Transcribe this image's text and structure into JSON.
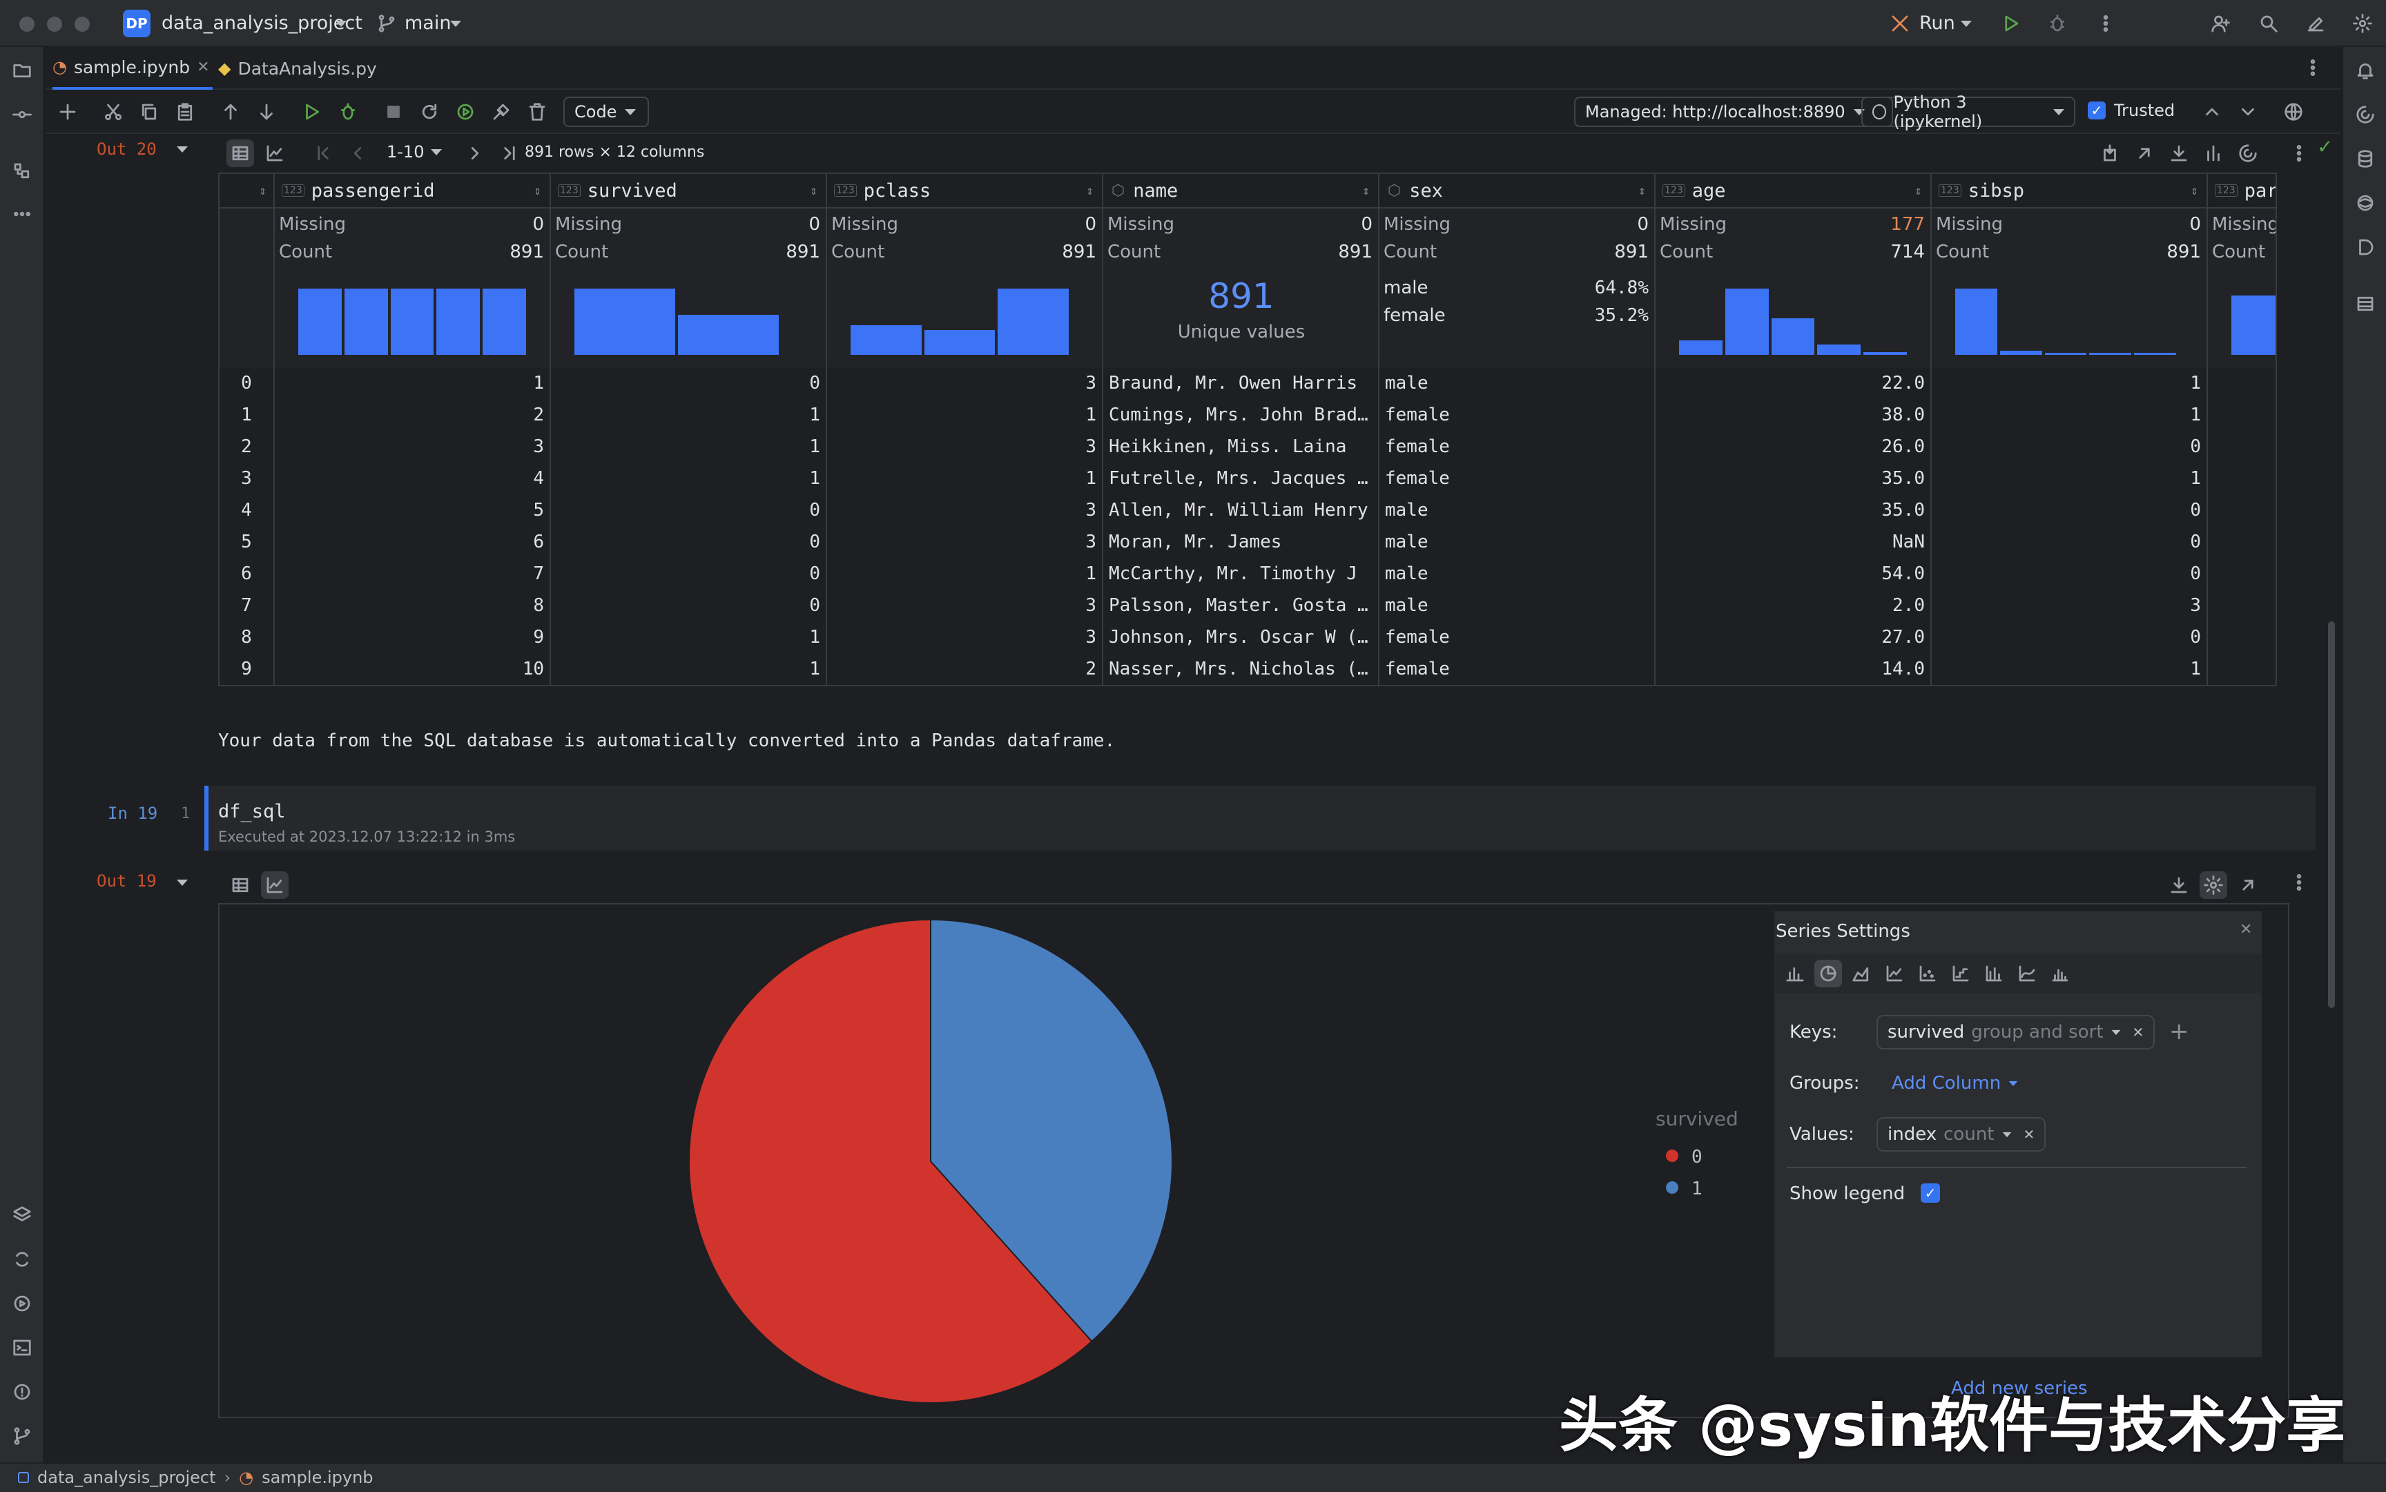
{
  "titlebar": {
    "project_badge": "DP",
    "project_name": "data_analysis_project",
    "branch": "main",
    "run_label": "Run"
  },
  "tabs": [
    {
      "label": "sample.ipynb",
      "active": true
    },
    {
      "label": "DataAnalysis.py",
      "active": false
    }
  ],
  "toolbar": {
    "cell_type": "Code",
    "server": "Managed: http://localhost:8890",
    "kernel": "Python 3 (ipykernel)",
    "trusted_label": "Trusted"
  },
  "out20": {
    "label": "Out 20",
    "pager": "1-10",
    "shape": "891 rows × 12 columns",
    "columns": [
      {
        "name": "passengerid",
        "missing": "0",
        "count": "891",
        "bars": [
          1,
          1,
          1,
          1,
          1
        ]
      },
      {
        "name": "survived",
        "missing": "0",
        "count": "891",
        "bars": [
          1,
          0.6
        ]
      },
      {
        "name": "pclass",
        "missing": "0",
        "count": "891",
        "bars": [
          0.45,
          0.38,
          1
        ]
      },
      {
        "name": "name",
        "missing": "0",
        "count": "891",
        "unique": "891",
        "unique_label": "Unique values"
      },
      {
        "name": "sex",
        "missing": "0",
        "count": "891",
        "cats": [
          {
            "label": "male",
            "pct": "64.8%"
          },
          {
            "label": "female",
            "pct": "35.2%"
          }
        ]
      },
      {
        "name": "age",
        "missing": "177",
        "count": "714",
        "bars": [
          0.22,
          1,
          0.55,
          0.16,
          0.04
        ]
      },
      {
        "name": "sibsp",
        "missing": "0",
        "count": "891",
        "bars": [
          1,
          0.06,
          0.03,
          0.03,
          0.02
        ]
      },
      {
        "name": "parch",
        "missing": "",
        "count": "",
        "bars": [
          1
        ]
      }
    ],
    "summary_labels": {
      "missing": "Missing",
      "count": "Count"
    },
    "rows": [
      {
        "idx": "0",
        "passengerid": "1",
        "survived": "0",
        "pclass": "3",
        "name": "Braund, Mr. Owen Harris",
        "sex": "male",
        "age": "22.0",
        "sibsp": "1"
      },
      {
        "idx": "1",
        "passengerid": "2",
        "survived": "1",
        "pclass": "1",
        "name": "Cumings, Mrs. John Brad…",
        "sex": "female",
        "age": "38.0",
        "sibsp": "1"
      },
      {
        "idx": "2",
        "passengerid": "3",
        "survived": "1",
        "pclass": "3",
        "name": "Heikkinen, Miss. Laina",
        "sex": "female",
        "age": "26.0",
        "sibsp": "0"
      },
      {
        "idx": "3",
        "passengerid": "4",
        "survived": "1",
        "pclass": "1",
        "name": "Futrelle, Mrs. Jacques …",
        "sex": "female",
        "age": "35.0",
        "sibsp": "1"
      },
      {
        "idx": "4",
        "passengerid": "5",
        "survived": "0",
        "pclass": "3",
        "name": "Allen, Mr. William Henry",
        "sex": "male",
        "age": "35.0",
        "sibsp": "0"
      },
      {
        "idx": "5",
        "passengerid": "6",
        "survived": "0",
        "pclass": "3",
        "name": "Moran, Mr. James",
        "sex": "male",
        "age": "NaN",
        "sibsp": "0"
      },
      {
        "idx": "6",
        "passengerid": "7",
        "survived": "0",
        "pclass": "1",
        "name": "McCarthy, Mr. Timothy J",
        "sex": "male",
        "age": "54.0",
        "sibsp": "0"
      },
      {
        "idx": "7",
        "passengerid": "8",
        "survived": "0",
        "pclass": "3",
        "name": "Palsson, Master. Gosta …",
        "sex": "male",
        "age": "2.0",
        "sibsp": "3"
      },
      {
        "idx": "8",
        "passengerid": "9",
        "survived": "1",
        "pclass": "3",
        "name": "Johnson, Mrs. Oscar W (…",
        "sex": "female",
        "age": "27.0",
        "sibsp": "0"
      },
      {
        "idx": "9",
        "passengerid": "10",
        "survived": "1",
        "pclass": "2",
        "name": "Nasser, Mrs. Nicholas (…",
        "sex": "female",
        "age": "14.0",
        "sibsp": "1"
      }
    ]
  },
  "markdown": "Your data from the SQL database is automatically converted into a Pandas dataframe.",
  "in19": {
    "label": "In 19",
    "line_no": "1",
    "code": "df_sql",
    "executed": "Executed at 2023.12.07 13:22:12 in 3ms"
  },
  "out19": {
    "label": "Out 19"
  },
  "chart_data": {
    "type": "pie",
    "legend_title": "survived",
    "legend_position": "right",
    "slices": [
      {
        "label": "0",
        "value": 549,
        "color": "#d0342c"
      },
      {
        "label": "1",
        "value": 342,
        "color": "#4a7fbf"
      }
    ]
  },
  "series_settings": {
    "title": "Series Settings",
    "keys_label": "Keys:",
    "key_col": "survived",
    "key_mode": "group and sort",
    "groups_label": "Groups:",
    "add_column": "Add Column",
    "values_label": "Values:",
    "value_col": "index",
    "value_agg": "count",
    "show_legend": "Show legend",
    "add_series": "Add new series"
  },
  "statusbar": {
    "path1": "data_analysis_project",
    "path2": "sample.ipynb"
  },
  "watermark": "头条 @sysin软件与技术分享"
}
